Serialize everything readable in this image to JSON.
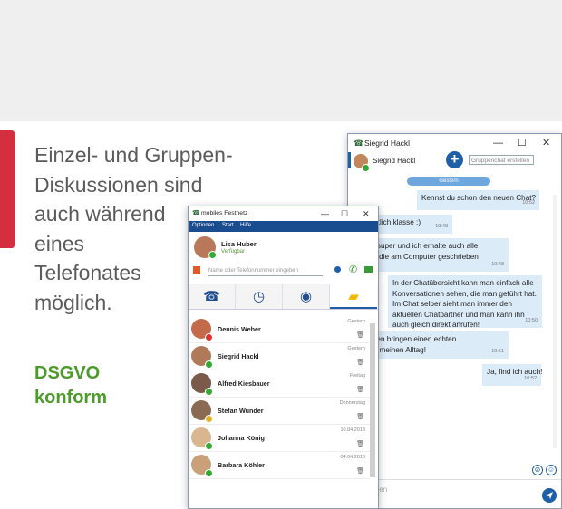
{
  "headline": [
    "Einzel- und Gruppen-",
    "Diskussionen sind",
    "auch während",
    "eines",
    "Telefonates",
    "möglich."
  ],
  "badge": [
    "DSGVO",
    "konform"
  ],
  "colors": {
    "accent_red": "#d32f3f",
    "brand_blue": "#1f5fa8",
    "menu_blue": "#1a4c90",
    "green": "#4c9a2a"
  },
  "chat_window": {
    "title": "Siegrid Hackl",
    "contact_name": "Siegrid Hackl",
    "group_chat_placeholder": "Gruppenchat erstellen",
    "date_label": "Gestern",
    "messages": [
      {
        "dir": "out",
        "lines": [
          "Kennst du schon den neuen Chat?"
        ],
        "time": "10:52"
      },
      {
        "dir": "in",
        "lines": [
          "r ist wirklich klasse :)"
        ],
        "time": "10:48"
      },
      {
        "dir": "in",
        "lines": [
          "tioniert super und ich erhalte auch alle",
          "richten, die am Computer geschrieben",
          "den."
        ],
        "time": "10:48"
      },
      {
        "dir": "out",
        "lines": [
          "In der Chatübersicht kann man einfach alle",
          "Konversationen sehen, die man geführt hat.",
          "Im Chat selber sieht man immer den",
          "aktuellen Chatpartner und man kann ihn",
          "auch gleich direkt anrufen!"
        ],
        "time": "10:50"
      },
      {
        "dir": "in",
        "lines": [
          "unktionen bringen einen echten",
          "wert für meinen Alltag!"
        ],
        "time": "10:51"
      },
      {
        "dir": "out",
        "lines": [
          "Ja, find ich auch!"
        ],
        "time": "10:52"
      }
    ],
    "input_placeholder": "it eingeben"
  },
  "app_window": {
    "title": "mobiles Festnetz",
    "menu": [
      "Optionen",
      "Start",
      "Hilfe"
    ],
    "user_name": "Lisa Huber",
    "user_status": "Verfügbar",
    "dial_placeholder": "Name oder Telefonnummer eingeben",
    "tabs": [
      "phone-tab",
      "history-tab",
      "contacts-tab",
      "chat-tab"
    ],
    "conversations": [
      {
        "name": "Dennis Weber",
        "date": "Gestern",
        "status_color": "#d33",
        "avatar_color": "#c46a4a"
      },
      {
        "name": "Siegrid Hackl",
        "date": "Gestern",
        "status_color": "#3a3",
        "avatar_color": "#b07a5a"
      },
      {
        "name": "Alfred Kiesbauer",
        "date": "Freitag",
        "status_color": "#3a3",
        "avatar_color": "#7a5a4a"
      },
      {
        "name": "Stefan Wunder",
        "date": "Donnerstag",
        "status_color": "#e3b020",
        "avatar_color": "#8a6a52"
      },
      {
        "name": "Johanna König",
        "date": "10.04.2018",
        "status_color": "#3a3",
        "avatar_color": "#d9b690"
      },
      {
        "name": "Barbara Köhler",
        "date": "04.04.2018",
        "status_color": "#3a3",
        "avatar_color": "#c9a07a"
      }
    ]
  }
}
